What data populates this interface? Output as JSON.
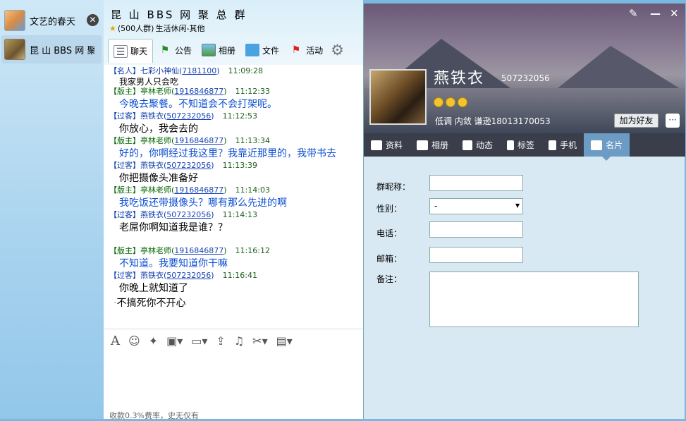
{
  "sidebar": {
    "items": [
      {
        "name": "文艺的春天"
      },
      {
        "name": "昆 山 BBS 网 聚 总"
      }
    ],
    "close_glyph": "✕"
  },
  "group": {
    "title": "昆 山 BBS 网 聚 总 群",
    "member_count": "(500人群)",
    "category": "生活休闲-其他",
    "tabs": [
      {
        "label": "聊天",
        "icon": "chat-icon"
      },
      {
        "label": "公告",
        "icon": "announcement-icon"
      },
      {
        "label": "相册",
        "icon": "album-icon"
      },
      {
        "label": "文件",
        "icon": "folder-icon"
      },
      {
        "label": "活动",
        "icon": "flag-icon"
      }
    ]
  },
  "messages": [
    {
      "role": "【名人】",
      "name": "七彩小神仙",
      "id": "7181100",
      "time": "11:09:28",
      "text": "我家男人只会吃",
      "style": "sm-dark"
    },
    {
      "role": "【版主】",
      "name": "亭林老师",
      "id": "1916846877",
      "time": "11:12:33",
      "text": "今晚去聚餐。不知道会不会打架呢。",
      "style": "blue"
    },
    {
      "role": "【过客】",
      "name": "燕铁衣",
      "id": "507232056",
      "time": "11:12:53",
      "text": "你放心，我会去的",
      "style": "dark"
    },
    {
      "role": "【版主】",
      "name": "亭林老师",
      "id": "1916846877",
      "time": "11:13:34",
      "text": "好的，你啊经过我这里？我靠近那里的，我带书去",
      "style": "blue"
    },
    {
      "role": "【过客】",
      "name": "燕铁衣",
      "id": "507232056",
      "time": "11:13:39",
      "text": "你把摄像头准备好",
      "style": "dark"
    },
    {
      "role": "【版主】",
      "name": "亭林老师",
      "id": "1916846877",
      "time": "11:14:03",
      "text": "我吃饭还带摄像头？哪有那么先进的啊",
      "style": "blue"
    },
    {
      "role": "【过客】",
      "name": "燕铁衣",
      "id": "507232056",
      "time": "11:14:13",
      "text": "老屌你啊知道我是谁？？",
      "style": "dark"
    },
    {
      "role": "【版主】",
      "name": "亭林老师",
      "id": "1916846877",
      "time": "11:16:12",
      "text": "不知道。我要知道你干嘛",
      "style": "blue"
    },
    {
      "role": "【过客】",
      "name": "燕铁衣",
      "id": "507232056",
      "time": "11:16:41",
      "text": "你晚上就知道了",
      "text2": "不搞死你不开心",
      "style": "dark"
    }
  ],
  "compose": {
    "tools": [
      "font-icon",
      "emoji-icon",
      "magic-icon",
      "gift-icon",
      "image-icon",
      "upload-icon",
      "music-icon",
      "scissors-icon",
      "more-icon"
    ],
    "ad": "收款0.3%费率，史无仅有"
  },
  "profile": {
    "name": "燕铁衣",
    "qq": "507232056",
    "signature": "低调  内敛  谦逊18013170053",
    "add_friend": "加为好友",
    "tabs": [
      {
        "label": "资料",
        "icon": "profile-icon"
      },
      {
        "label": "相册",
        "icon": "album-icon"
      },
      {
        "label": "动态",
        "icon": "feed-icon"
      },
      {
        "label": "标签",
        "icon": "tag-icon"
      },
      {
        "label": "手机",
        "icon": "phone-icon"
      },
      {
        "label": "名片",
        "icon": "card-icon"
      }
    ],
    "fields": {
      "nickname_label": "群昵称：",
      "gender_label": "性别：",
      "gender_value": "-",
      "phone_label": "电话：",
      "email_label": "邮箱：",
      "note_label": "备注："
    }
  },
  "colors": {
    "manager": "#006600",
    "guest": "#0a3aa8",
    "banner_tab": "#6c9cc4"
  }
}
